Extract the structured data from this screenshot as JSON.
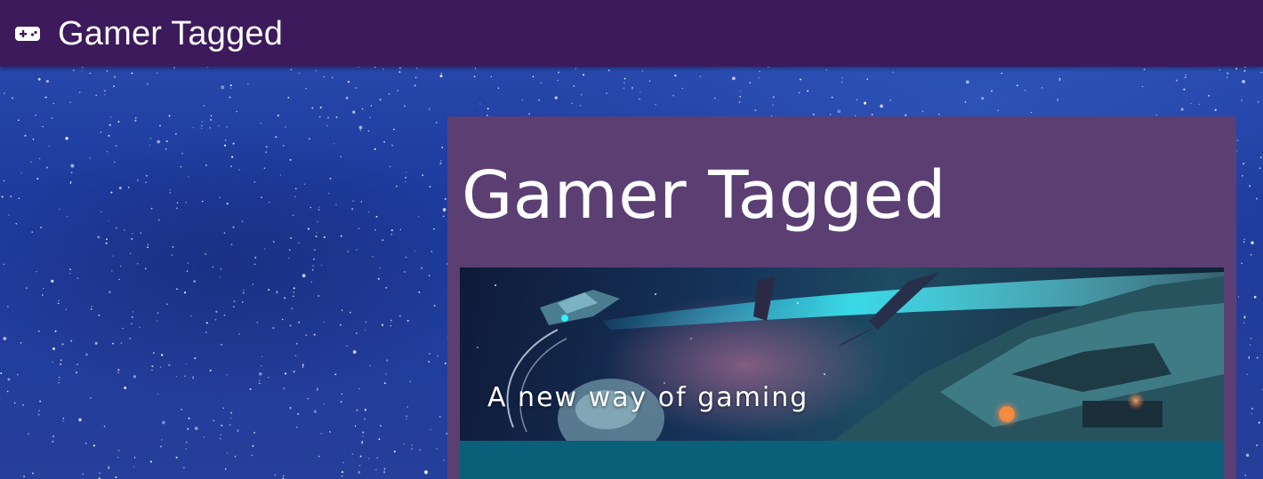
{
  "app": {
    "title": "Gamer Tagged",
    "icon": "gamepad-icon"
  },
  "hero": {
    "title": "Gamer Tagged",
    "tagline": "A new way of gaming"
  },
  "colors": {
    "appbar": "#3c1a5b",
    "card": "#5b3f73",
    "footer": "#0b6079",
    "background": "#1f3d9a"
  }
}
